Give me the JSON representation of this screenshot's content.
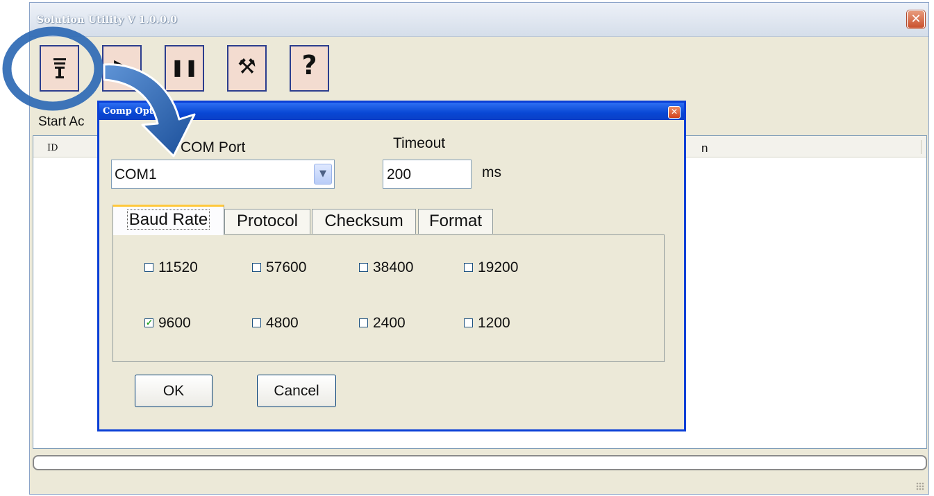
{
  "window": {
    "title": "Solution Utility V 1.0.0.0",
    "close_glyph": "✕"
  },
  "toolbar": {
    "buttons": [
      {
        "icon": "serial-port-icon",
        "glyph": "⊤"
      },
      {
        "icon": "play-icon",
        "glyph": "▶"
      },
      {
        "icon": "pause-icon",
        "glyph": "❚❚"
      },
      {
        "icon": "tools-icon",
        "glyph": "⚒"
      },
      {
        "icon": "help-icon",
        "glyph": "?"
      }
    ]
  },
  "main": {
    "status_label": "Start Ac",
    "columns": {
      "id": "ID",
      "partial": "n"
    }
  },
  "dialog": {
    "title": "Comp   Option",
    "close_glyph": "✕",
    "com_port_label": "COM Port",
    "com_port_value": "COM1",
    "timeout_label": "Timeout",
    "timeout_value": "200",
    "timeout_unit": "ms",
    "tabs": [
      "Baud Rate",
      "Protocol",
      "Checksum",
      "Format"
    ],
    "active_tab": "Baud Rate",
    "baud_rates": [
      {
        "label": "11520",
        "checked": false
      },
      {
        "label": "57600",
        "checked": false
      },
      {
        "label": "38400",
        "checked": false
      },
      {
        "label": "19200",
        "checked": false
      },
      {
        "label": "9600",
        "checked": true
      },
      {
        "label": "4800",
        "checked": false
      },
      {
        "label": "2400",
        "checked": false
      },
      {
        "label": "1200",
        "checked": false
      }
    ],
    "ok_label": "OK",
    "cancel_label": "Cancel"
  },
  "colors": {
    "dialog_title": "#0a47d4",
    "toolbar_button_bg": "#f3dcd0",
    "callout_blue": "#2f6bb5",
    "window_bg": "#ece9d8"
  }
}
